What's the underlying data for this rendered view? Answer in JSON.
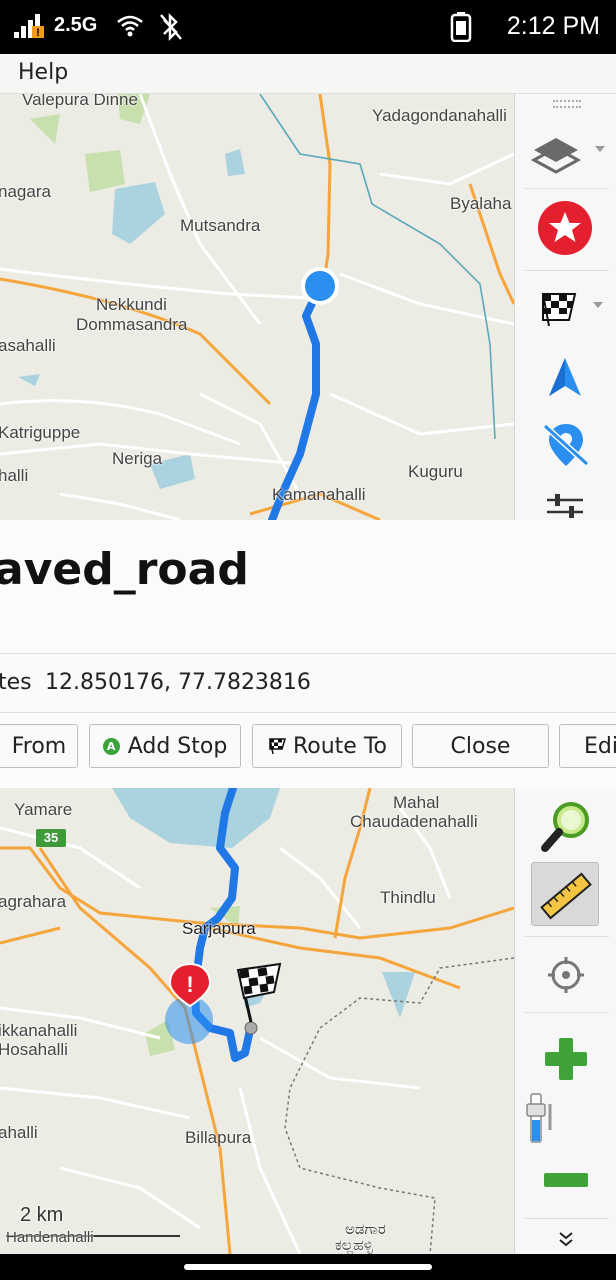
{
  "status_bar": {
    "network": "2.5G",
    "time": "2:12 PM"
  },
  "menu": {
    "help": "Help"
  },
  "map_top": {
    "labels": {
      "valepura": "Valepura Dinne",
      "yadagondanahalli": "Yadagondanahalli",
      "nagara": "nagara",
      "byalaha": "Byalaha",
      "mutsandra": "Mutsandra",
      "nekkundi": "Nekkundi",
      "dommasandra": "Dommasandra",
      "asahalli": "asahalli",
      "katriguppe": "Katriguppe",
      "neriga": "Neriga",
      "halli": "halli",
      "kuguru": "Kuguru",
      "kamanahalli": "Kamanahalli"
    }
  },
  "place": {
    "title": "aved_road",
    "coords_label": "tes",
    "coords_value": "12.850176, 77.7823816"
  },
  "actions": {
    "from": "From",
    "add_stop": "Add Stop",
    "add_stop_badge": "A",
    "route_to": "Route To",
    "close": "Close",
    "edit": "Edi"
  },
  "map_bottom": {
    "labels": {
      "yamare": "Yamare",
      "road_shield": "35",
      "mahal": "Mahal",
      "chaudadenahalli": "Chaudadenahalli",
      "agrahara": "agrahara",
      "thindlu": "Thindlu",
      "sarjapura": "Sarjapura",
      "ikkanahalli": "ikkanahalli",
      "hosahalli": "Hosahalli",
      "ahalli": "ahalli",
      "billapura": "Billapura",
      "handenahalli": "Handenahalli",
      "kannada_1": "ಅಡಗಾರ",
      "kannada_2": "ಕಲ್ಲಹಳ್ಳಿ"
    },
    "scale": "2 km"
  },
  "colors": {
    "route": "#1f78e6",
    "location": "#2b8ff0",
    "favorite": "#e5202e",
    "zoom_in": "#3fa33a",
    "water": "#aad3df",
    "park": "#c8dfae",
    "road_orange": "#f5a53a"
  }
}
